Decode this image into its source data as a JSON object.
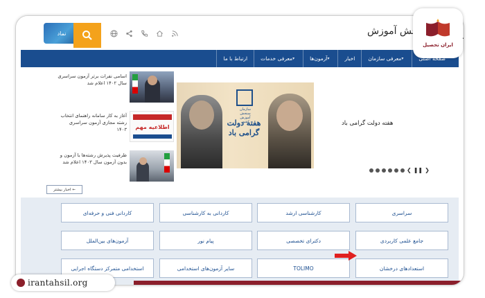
{
  "header": {
    "org_title": "سازمان سنجش آموزش کشور",
    "emblem_text": "نماد"
  },
  "nav": {
    "items": [
      {
        "label": "صفحه اصلی",
        "dropdown": false
      },
      {
        "label": "معرفی سازمان",
        "dropdown": true
      },
      {
        "label": "اخبار",
        "dropdown": false
      },
      {
        "label": "آزمون‌ها",
        "dropdown": true
      },
      {
        "label": "معرفی خدمات",
        "dropdown": true
      },
      {
        "label": "ارتباط با ما",
        "dropdown": false
      }
    ]
  },
  "news": [
    {
      "text": "اسامی نفرات برتر آزمون سراسری سال ۱۴۰۲ اعلام شد"
    },
    {
      "text": "آغاز به کار سامانه راهنمای انتخاب رشته مجازی آزمون سراسری ۱۴۰۳"
    },
    {
      "text": "ظرفیت پذیرش رشته‌ها با آزمون و بدون آزمون سال ۱۴۰۳ اعلام شد"
    }
  ],
  "thumb2_text": "اطلاعیه مهم",
  "banner": {
    "headline": "هفته دولت گرامی باد",
    "logo_caption": "سازمان سنجش آموزش کشور"
  },
  "slide_title": "هفته دولت گرامی باد",
  "more_news": "اخبار بیشتر ←",
  "grid": {
    "row1": [
      "سراسری",
      "کارشناسی ارشد",
      "کاردانی به کارشناسی",
      "کاردانی فنی و حرفه‌ای"
    ],
    "row2": [
      "جامع علمی کاربردی",
      "دکترای تخصصی",
      "پیام نور",
      "آزمون‌های بین‌الملل"
    ],
    "row3": [
      "استعدادهای درخشان",
      "TOLIMO",
      "سایر آزمون‌های استخدامی",
      "استخدامی متمرکز دستگاه اجرایی"
    ]
  },
  "site_badge": "irantahsil.org",
  "brand_name": "ایران تحصیل",
  "colors": {
    "nav_blue": "#1a4d8f",
    "search_orange": "#f4a21b",
    "grid_bg": "#e6ecf3",
    "accent_red": "#e02020",
    "brand_maroon": "#8b1f2b"
  }
}
